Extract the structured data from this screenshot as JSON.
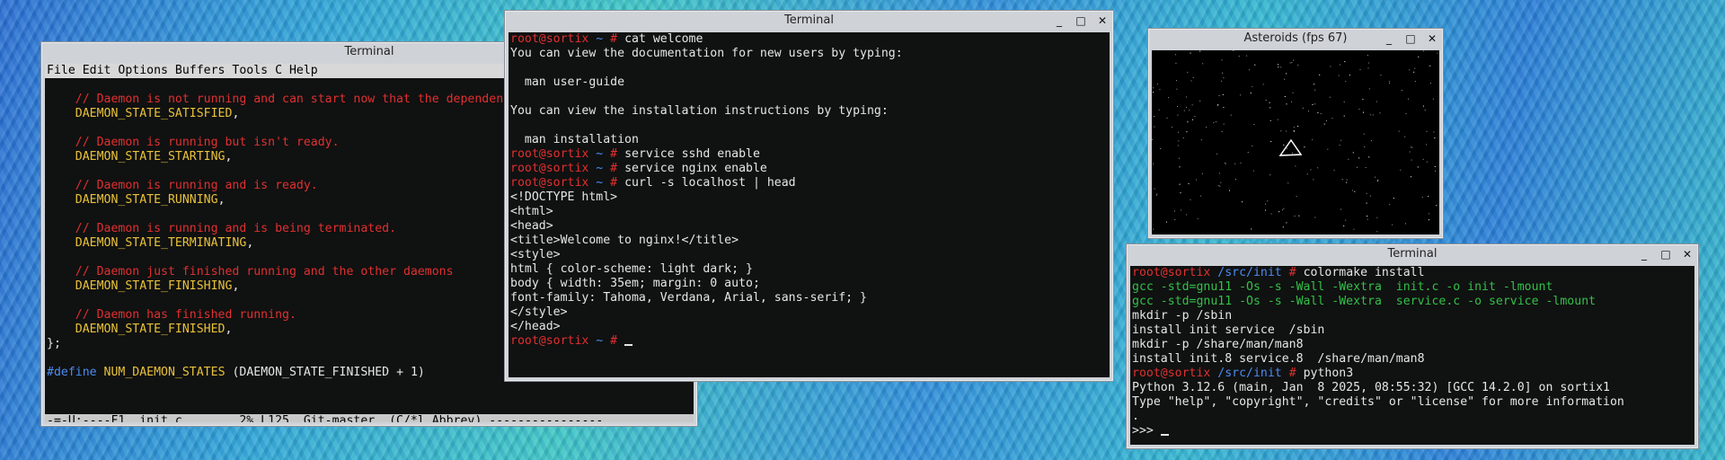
{
  "emacs_window": {
    "title": "Terminal",
    "menu": "File Edit Options Buffers Tools C Help",
    "lines": [
      {
        "parts": [
          {
            "t": "",
            "c": "white"
          }
        ]
      },
      {
        "parts": [
          {
            "t": "    // Daemon is not running and can start now that the dependencies are ready.",
            "c": "red"
          }
        ]
      },
      {
        "parts": [
          {
            "t": "    DAEMON_STATE_SATISFIED",
            "c": "yellow"
          },
          {
            "t": ",",
            "c": "white"
          }
        ]
      },
      {
        "parts": [
          {
            "t": "",
            "c": "white"
          }
        ]
      },
      {
        "parts": [
          {
            "t": "    // Daemon is running but isn't ready.",
            "c": "red"
          }
        ]
      },
      {
        "parts": [
          {
            "t": "    DAEMON_STATE_STARTING",
            "c": "yellow"
          },
          {
            "t": ",",
            "c": "white"
          }
        ]
      },
      {
        "parts": [
          {
            "t": "",
            "c": "white"
          }
        ]
      },
      {
        "parts": [
          {
            "t": "    // Daemon is running and is ready.",
            "c": "red"
          }
        ]
      },
      {
        "parts": [
          {
            "t": "    DAEMON_STATE_RUNNING",
            "c": "yellow"
          },
          {
            "t": ",",
            "c": "white"
          }
        ]
      },
      {
        "parts": [
          {
            "t": "",
            "c": "white"
          }
        ]
      },
      {
        "parts": [
          {
            "t": "    // Daemon is running and is being terminated.",
            "c": "red"
          }
        ]
      },
      {
        "parts": [
          {
            "t": "    DAEMON_STATE_TERMINATING",
            "c": "yellow"
          },
          {
            "t": ",",
            "c": "white"
          }
        ]
      },
      {
        "parts": [
          {
            "t": "",
            "c": "white"
          }
        ]
      },
      {
        "parts": [
          {
            "t": "    // Daemon just finished running and the other daemons",
            "c": "red"
          }
        ]
      },
      {
        "parts": [
          {
            "t": "    DAEMON_STATE_FINISHING",
            "c": "yellow"
          },
          {
            "t": ",",
            "c": "white"
          }
        ]
      },
      {
        "parts": [
          {
            "t": "",
            "c": "white"
          }
        ]
      },
      {
        "parts": [
          {
            "t": "    // Daemon has finished running.",
            "c": "red"
          }
        ]
      },
      {
        "parts": [
          {
            "t": "    DAEMON_STATE_FINISHED",
            "c": "yellow"
          },
          {
            "t": ",",
            "c": "white"
          }
        ]
      },
      {
        "parts": [
          {
            "t": "};",
            "c": "white"
          }
        ]
      },
      {
        "parts": [
          {
            "t": "",
            "c": "white"
          }
        ]
      },
      {
        "parts": [
          {
            "t": "#define ",
            "c": "blue"
          },
          {
            "t": "NUM_DAEMON_STATES",
            "c": "yellow"
          },
          {
            "t": " (DAEMON_STATE_FINISHED + 1)",
            "c": "white"
          }
        ]
      },
      {
        "parts": [
          {
            "t": "",
            "c": "white"
          }
        ]
      }
    ],
    "modeline": "-=-U:----F1  init.c        2% L125  Git-master  (C/*l Abbrev) ----------------"
  },
  "welcome_window": {
    "title": "Terminal",
    "lines": [
      {
        "parts": [
          {
            "t": "root@sortix",
            "c": "red"
          },
          {
            "t": " ~ ",
            "c": "blue"
          },
          {
            "t": "# ",
            "c": "red"
          },
          {
            "t": "cat welcome",
            "c": "white"
          }
        ]
      },
      {
        "parts": [
          {
            "t": "You can view the documentation for new users by typing:",
            "c": "white"
          }
        ]
      },
      {
        "parts": [
          {
            "t": "",
            "c": "white"
          }
        ]
      },
      {
        "parts": [
          {
            "t": "  man user-guide",
            "c": "white"
          }
        ]
      },
      {
        "parts": [
          {
            "t": "",
            "c": "white"
          }
        ]
      },
      {
        "parts": [
          {
            "t": "You can view the installation instructions by typing:",
            "c": "white"
          }
        ]
      },
      {
        "parts": [
          {
            "t": "",
            "c": "white"
          }
        ]
      },
      {
        "parts": [
          {
            "t": "  man installation",
            "c": "white"
          }
        ]
      },
      {
        "parts": [
          {
            "t": "root@sortix",
            "c": "red"
          },
          {
            "t": " ~ ",
            "c": "blue"
          },
          {
            "t": "# ",
            "c": "red"
          },
          {
            "t": "service sshd enable",
            "c": "white"
          }
        ]
      },
      {
        "parts": [
          {
            "t": "root@sortix",
            "c": "red"
          },
          {
            "t": " ~ ",
            "c": "blue"
          },
          {
            "t": "# ",
            "c": "red"
          },
          {
            "t": "service nginx enable",
            "c": "white"
          }
        ]
      },
      {
        "parts": [
          {
            "t": "root@sortix",
            "c": "red"
          },
          {
            "t": " ~ ",
            "c": "blue"
          },
          {
            "t": "# ",
            "c": "red"
          },
          {
            "t": "curl -s localhost | head",
            "c": "white"
          }
        ]
      },
      {
        "parts": [
          {
            "t": "<!DOCTYPE html>",
            "c": "white"
          }
        ]
      },
      {
        "parts": [
          {
            "t": "<html>",
            "c": "white"
          }
        ]
      },
      {
        "parts": [
          {
            "t": "<head>",
            "c": "white"
          }
        ]
      },
      {
        "parts": [
          {
            "t": "<title>Welcome to nginx!</title>",
            "c": "white"
          }
        ]
      },
      {
        "parts": [
          {
            "t": "<style>",
            "c": "white"
          }
        ]
      },
      {
        "parts": [
          {
            "t": "html { color-scheme: light dark; }",
            "c": "white"
          }
        ]
      },
      {
        "parts": [
          {
            "t": "body { width: 35em; margin: 0 auto;",
            "c": "white"
          }
        ]
      },
      {
        "parts": [
          {
            "t": "font-family: Tahoma, Verdana, Arial, sans-serif; }",
            "c": "white"
          }
        ]
      },
      {
        "parts": [
          {
            "t": "</style>",
            "c": "white"
          }
        ]
      },
      {
        "parts": [
          {
            "t": "</head>",
            "c": "white"
          }
        ]
      },
      {
        "parts": [
          {
            "t": "root@sortix",
            "c": "red"
          },
          {
            "t": " ~ ",
            "c": "blue"
          },
          {
            "t": "# ",
            "c": "red"
          }
        ]
      }
    ]
  },
  "asteroids_window": {
    "title": "Asteroids (fps 67)"
  },
  "make_window": {
    "title": "Terminal",
    "lines": [
      {
        "parts": [
          {
            "t": "root@sortix",
            "c": "red"
          },
          {
            "t": " /src/init ",
            "c": "blue"
          },
          {
            "t": "# ",
            "c": "red"
          },
          {
            "t": "colormake install",
            "c": "white"
          }
        ]
      },
      {
        "parts": [
          {
            "t": "gcc -std=gnu11 -Os -s -Wall -Wextra  init.c -o init -lmount",
            "c": "green"
          }
        ]
      },
      {
        "parts": [
          {
            "t": "gcc -std=gnu11 -Os -s -Wall -Wextra  service.c -o service -lmount",
            "c": "green"
          }
        ]
      },
      {
        "parts": [
          {
            "t": "mkdir -p /sbin",
            "c": "white"
          }
        ]
      },
      {
        "parts": [
          {
            "t": "install init service  /sbin",
            "c": "white"
          }
        ]
      },
      {
        "parts": [
          {
            "t": "mkdir -p /share/man/man8",
            "c": "white"
          }
        ]
      },
      {
        "parts": [
          {
            "t": "install init.8 service.8  /share/man/man8",
            "c": "white"
          }
        ]
      },
      {
        "parts": [
          {
            "t": "root@sortix",
            "c": "red"
          },
          {
            "t": " /src/init ",
            "c": "blue"
          },
          {
            "t": "# ",
            "c": "red"
          },
          {
            "t": "python3",
            "c": "white"
          }
        ]
      },
      {
        "parts": [
          {
            "t": "Python 3.12.6 (main, Jan  8 2025, 08:55:32) [GCC 14.2.0] on sortix1",
            "c": "white"
          }
        ]
      },
      {
        "parts": [
          {
            "t": "Type \"help\", \"copyright\", \"credits\" or \"license\" for more information",
            "c": "white"
          }
        ]
      },
      {
        "parts": [
          {
            "t": ".",
            "c": "white"
          }
        ]
      },
      {
        "parts": [
          {
            "t": ">>> ",
            "c": "white"
          }
        ]
      }
    ]
  },
  "window_buttons": {
    "minimize": "_",
    "maximize": "□",
    "close": "✕"
  }
}
